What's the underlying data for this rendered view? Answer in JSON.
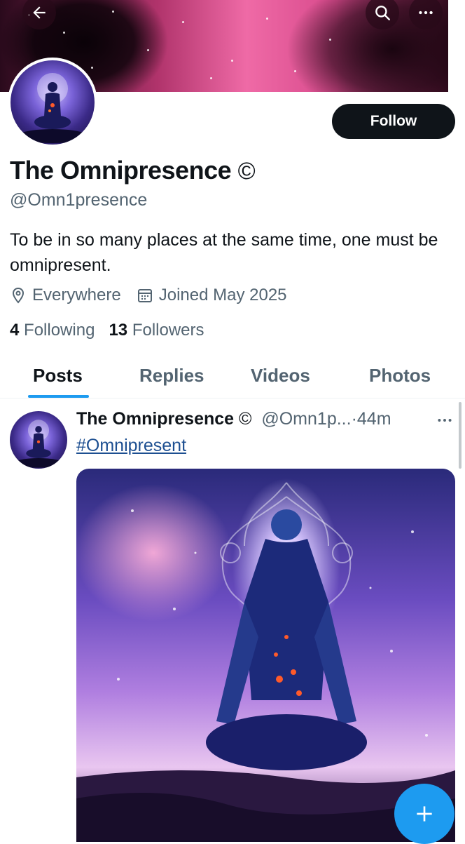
{
  "profile": {
    "display_name": "The Omnipresence",
    "badge": "©",
    "handle": "@Omn1presence",
    "bio": "To be in so many places at the same time, one must be omnipresent.",
    "location": "Everywhere",
    "joined": "Joined May 2025",
    "following_count": "4",
    "following_label": "Following",
    "followers_count": "13",
    "followers_label": "Followers"
  },
  "header": {
    "back_icon": "arrow-left-icon",
    "search_icon": "search-icon",
    "more_icon": "more-horizontal-icon"
  },
  "actions": {
    "follow_label": "Follow"
  },
  "tabs": [
    {
      "label": "Posts",
      "active": true
    },
    {
      "label": "Replies",
      "active": false
    },
    {
      "label": "Videos",
      "active": false
    },
    {
      "label": "Photos",
      "active": false
    }
  ],
  "post": {
    "author_name": "The Omnipresence",
    "badge": "©",
    "handle": "@Omn1p...",
    "separator": "·",
    "time": "44m",
    "text": "#Omnipresent"
  },
  "colors": {
    "accent": "#1d9bf0",
    "text": "#0f1419",
    "muted": "#536471",
    "follow_bg": "#0f1419"
  }
}
